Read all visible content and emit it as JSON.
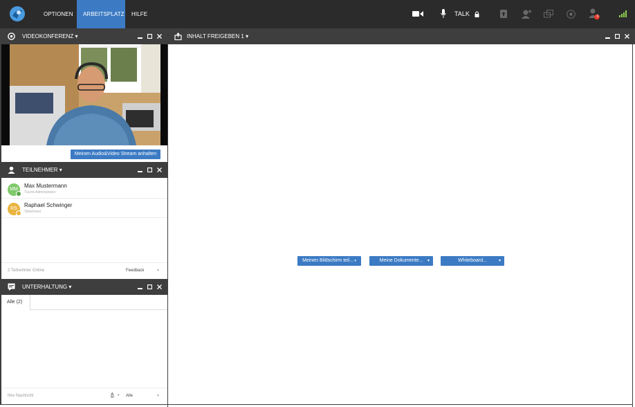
{
  "topbar": {
    "menu": [
      {
        "label": "OPTIONEN"
      },
      {
        "label": "ARBEITSPLATZ"
      },
      {
        "label": "HILFE"
      }
    ],
    "talk_label": "TALK",
    "notification_count": "0",
    "colors": {
      "bar": "#2b2b2b",
      "active": "#3c7bc4",
      "signal": "#8fd14f"
    }
  },
  "video_panel": {
    "title": "VIDEOKONFERENZ",
    "pause_stream_button": "Meinen Audio&Video Stream anhalten"
  },
  "participants_panel": {
    "title": "TEILNEHMER",
    "participants": [
      {
        "initials": "MM",
        "name": "Max Mustermann",
        "role": "TuLink Administrator",
        "avatar_color": "#7fc96a",
        "badge_color": "#5aa748"
      },
      {
        "initials": "RS",
        "name": "Raphael Schwinger",
        "role": "Teilnehmer",
        "avatar_color": "#e9b43f",
        "badge_color": "#e9b43f"
      }
    ],
    "online_count": "2 Teilnehmer Online",
    "feedback_label": "Feedback"
  },
  "chat_panel": {
    "title": "UNTERHALTUNG",
    "tab_all": "Alle (2)",
    "message_placeholder": "Ihre Nachricht",
    "recipient_select": "Alle"
  },
  "share_panel": {
    "title": "INHALT FREIGEBEN 1",
    "buttons": [
      {
        "label": "Meinen Bildschirm teil..."
      },
      {
        "label": "Meine Dokumente..."
      },
      {
        "label": "Whiteboard..."
      }
    ]
  }
}
